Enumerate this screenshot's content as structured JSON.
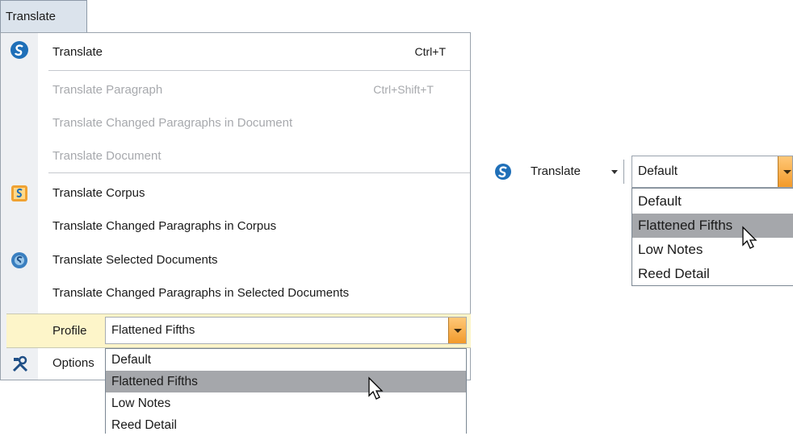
{
  "menu": {
    "tab_label": "Translate",
    "items": [
      {
        "label": "Translate",
        "shortcut": "Ctrl+T",
        "enabled": true,
        "icon": "translate-icon"
      },
      {
        "label": "Translate Paragraph",
        "shortcut": "Ctrl+Shift+T",
        "enabled": false
      },
      {
        "label": "Translate Changed Paragraphs in Document",
        "enabled": false
      },
      {
        "label": "Translate Document",
        "enabled": false
      },
      {
        "label": "Translate Corpus",
        "enabled": true,
        "icon": "translate-corpus-icon"
      },
      {
        "label": "Translate Changed Paragraphs in Corpus",
        "enabled": true
      },
      {
        "label": "Translate Selected Documents",
        "enabled": true,
        "icon": "translate-selected-documents-icon"
      },
      {
        "label": "Translate Changed Paragraphs in Selected Documents",
        "enabled": true
      }
    ],
    "profile_label": "Profile",
    "profile_value": "Flattened Fifths",
    "options_label": "Options",
    "profile_options": [
      "Default",
      "Flattened Fifths",
      "Low Notes",
      "Reed Detail"
    ],
    "highlighted_option": "Flattened Fifths"
  },
  "toolbar": {
    "translate_label": "Translate",
    "profile_value": "Default",
    "profile_options": [
      "Default",
      "Flattened Fifths",
      "Low Notes",
      "Reed Detail"
    ],
    "highlighted_option": "Flattened Fifths"
  },
  "colors": {
    "accent_orange": "#f29a2a",
    "highlight_gray": "#a5a7ab",
    "profile_row_bg": "#fdf5c9",
    "translate_icon_blue": "#1f6fb8"
  }
}
